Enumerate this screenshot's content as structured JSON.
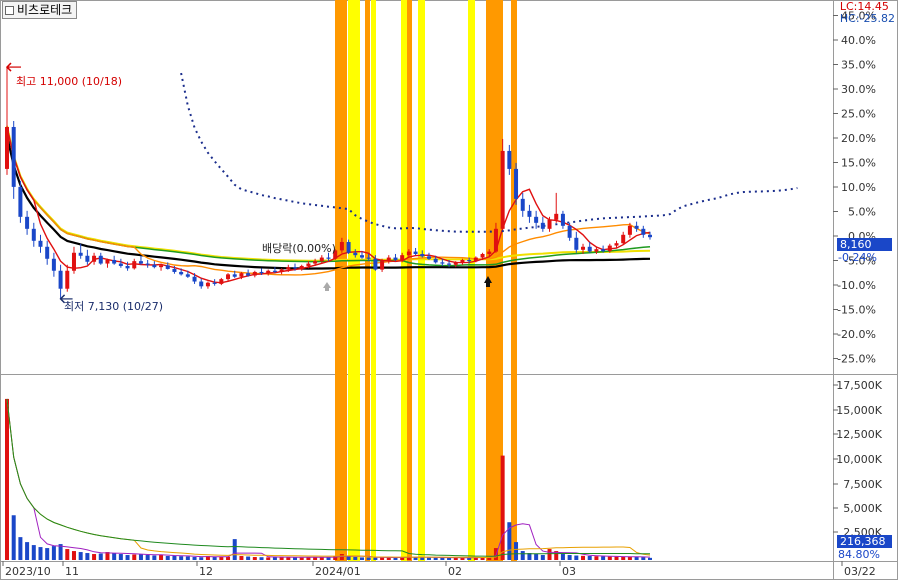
{
  "header": {
    "ticker": "비츠로테크"
  },
  "legend": {
    "lc": "LC:14.45",
    "hc": "HC:-25.82"
  },
  "current_price": "8,160",
  "change_pct": "-0.24%",
  "volume_current": "216,368",
  "volume_pct": "84.80%",
  "annotations": {
    "high": "최고 11,000 (10/18)",
    "low": "최저 7,130 (10/27)",
    "dividend": "배당락(0.00%)"
  },
  "colors": {
    "up": "#e01010",
    "down": "#1a47c8",
    "ma5": "#e01010",
    "ma20": "#ff8c00",
    "ma60": "#1f9a1f",
    "ma120": "#000000",
    "ma_long": "#f0e000",
    "band_orange": "#ff9900",
    "band_yellow": "#ffff00",
    "dotted": "#1a2d8c"
  },
  "chart_data": [
    {
      "type": "candlestick",
      "title": "비츠로테크",
      "y_axis_ticks": [
        "45.0%",
        "40.0%",
        "35.0%",
        "30.0%",
        "25.0%",
        "20.0%",
        "15.0%",
        "10.0%",
        "5.0%",
        "0.0%",
        "-5.0%",
        "-10.0%",
        "-15.0%",
        "-20.0%",
        "-25.0%"
      ],
      "x_axis_ticks": [
        "2023/10",
        "11",
        "12",
        "2024/01",
        "02",
        "03",
        "03/22"
      ],
      "ylim_pct": [
        -25,
        47
      ],
      "reference_price": 8180,
      "current_price": 8160,
      "high": {
        "price": 11000,
        "date": "10/18"
      },
      "low": {
        "price": 7130,
        "date": "10/27"
      },
      "ohlc": [
        [
          9300,
          11000,
          9200,
          10000
        ],
        [
          10000,
          10100,
          8800,
          9000
        ],
        [
          9000,
          9100,
          8400,
          8500
        ],
        [
          8500,
          8600,
          8200,
          8300
        ],
        [
          8300,
          8400,
          8000,
          8100
        ],
        [
          8100,
          8200,
          7900,
          8000
        ],
        [
          8000,
          8100,
          7700,
          7800
        ],
        [
          7800,
          7900,
          7500,
          7600
        ],
        [
          7600,
          7700,
          7130,
          7300
        ],
        [
          7300,
          7700,
          7250,
          7600
        ],
        [
          7600,
          8000,
          7550,
          7900
        ],
        [
          7900,
          8050,
          7800,
          7850
        ],
        [
          7850,
          7950,
          7700,
          7750
        ],
        [
          7750,
          7900,
          7700,
          7850
        ],
        [
          7850,
          7900,
          7700,
          7720
        ],
        [
          7720,
          7800,
          7650,
          7780
        ],
        [
          7780,
          7850,
          7700,
          7720
        ],
        [
          7720,
          7800,
          7650,
          7680
        ],
        [
          7680,
          7750,
          7600,
          7640
        ],
        [
          7640,
          7800,
          7620,
          7760
        ],
        [
          7760,
          7850,
          7700,
          7720
        ],
        [
          7720,
          7780,
          7650,
          7700
        ],
        [
          7700,
          7760,
          7640,
          7660
        ],
        [
          7660,
          7720,
          7600,
          7690
        ],
        [
          7690,
          7740,
          7620,
          7630
        ],
        [
          7630,
          7680,
          7550,
          7580
        ],
        [
          7580,
          7640,
          7520,
          7540
        ],
        [
          7540,
          7600,
          7480,
          7500
        ],
        [
          7500,
          7560,
          7380,
          7420
        ],
        [
          7420,
          7470,
          7300,
          7340
        ],
        [
          7340,
          7420,
          7300,
          7400
        ],
        [
          7400,
          7460,
          7350,
          7380
        ],
        [
          7380,
          7480,
          7360,
          7460
        ],
        [
          7460,
          7560,
          7430,
          7540
        ],
        [
          7540,
          7600,
          7480,
          7500
        ],
        [
          7500,
          7580,
          7460,
          7560
        ],
        [
          7560,
          7620,
          7500,
          7520
        ],
        [
          7520,
          7600,
          7490,
          7580
        ],
        [
          7580,
          7640,
          7530,
          7560
        ],
        [
          7560,
          7620,
          7520,
          7600
        ],
        [
          7600,
          7660,
          7560,
          7580
        ],
        [
          7580,
          7640,
          7540,
          7620
        ],
        [
          7620,
          7700,
          7580,
          7660
        ],
        [
          7660,
          7720,
          7600,
          7640
        ],
        [
          7640,
          7700,
          7600,
          7680
        ],
        [
          7680,
          7760,
          7640,
          7720
        ],
        [
          7720,
          7800,
          7680,
          7760
        ],
        [
          7760,
          7860,
          7720,
          7820
        ],
        [
          7820,
          7900,
          7760,
          7800
        ],
        [
          7800,
          7960,
          7780,
          7940
        ],
        [
          7940,
          8150,
          7900,
          8080
        ],
        [
          8080,
          8120,
          7880,
          7900
        ],
        [
          7900,
          7960,
          7820,
          7860
        ],
        [
          7860,
          7920,
          7800,
          7820
        ],
        [
          7820,
          7880,
          7760,
          7800
        ],
        [
          7800,
          7860,
          7600,
          7620
        ],
        [
          7620,
          7800,
          7580,
          7760
        ],
        [
          7760,
          7860,
          7720,
          7820
        ],
        [
          7820,
          7880,
          7760,
          7780
        ],
        [
          7780,
          7900,
          7740,
          7860
        ],
        [
          7860,
          7960,
          7820,
          7920
        ],
        [
          7920,
          7980,
          7860,
          7880
        ],
        [
          7880,
          7940,
          7820,
          7840
        ],
        [
          7840,
          7900,
          7780,
          7800
        ],
        [
          7800,
          7850,
          7720,
          7740
        ],
        [
          7740,
          7800,
          7680,
          7720
        ],
        [
          7720,
          7780,
          7660,
          7700
        ],
        [
          7700,
          7760,
          7660,
          7740
        ],
        [
          7740,
          7800,
          7700,
          7780
        ],
        [
          7780,
          7820,
          7720,
          7760
        ],
        [
          7760,
          7840,
          7740,
          7820
        ],
        [
          7820,
          7900,
          7780,
          7880
        ],
        [
          7880,
          7960,
          7840,
          7920
        ],
        [
          7920,
          8400,
          7900,
          8300
        ],
        [
          8300,
          9800,
          8280,
          9600
        ],
        [
          9600,
          9700,
          9200,
          9300
        ],
        [
          9300,
          9400,
          8700,
          8800
        ],
        [
          8800,
          8900,
          8500,
          8600
        ],
        [
          8600,
          8700,
          8400,
          8500
        ],
        [
          8500,
          8600,
          8300,
          8400
        ],
        [
          8400,
          8500,
          8250,
          8300
        ],
        [
          8300,
          8500,
          8250,
          8450
        ],
        [
          8450,
          8900,
          8400,
          8550
        ],
        [
          8550,
          8600,
          8300,
          8350
        ],
        [
          8350,
          8400,
          8100,
          8150
        ],
        [
          8150,
          8250,
          7900,
          7950
        ],
        [
          7950,
          8050,
          7880,
          8000
        ],
        [
          8000,
          8080,
          7900,
          7920
        ],
        [
          7920,
          8000,
          7880,
          7960
        ],
        [
          7960,
          8020,
          7900,
          7930
        ],
        [
          7930,
          8050,
          7900,
          8020
        ],
        [
          8020,
          8100,
          7980,
          8060
        ],
        [
          8060,
          8250,
          8040,
          8200
        ],
        [
          8200,
          8400,
          8150,
          8350
        ],
        [
          8350,
          8420,
          8250,
          8300
        ],
        [
          8300,
          8350,
          8150,
          8200
        ],
        [
          8200,
          8250,
          8120,
          8160
        ]
      ],
      "volume_k": [
        16200,
        4500,
        2300,
        1800,
        1500,
        1300,
        1200,
        1400,
        1600,
        1100,
        900,
        800,
        700,
        600,
        650,
        800,
        700,
        600,
        500,
        550,
        600,
        500,
        450,
        500,
        400,
        420,
        380,
        350,
        300,
        280,
        400,
        350,
        300,
        320,
        2100,
        400,
        350,
        300,
        280,
        260,
        300,
        320,
        280,
        260,
        240,
        260,
        300,
        280,
        260,
        350,
        600,
        400,
        300,
        260,
        240,
        230,
        280,
        260,
        240,
        260,
        300,
        280,
        260,
        240,
        230,
        220,
        240,
        260,
        230,
        220,
        240,
        260,
        300,
        1200,
        10500,
        3800,
        1800,
        900,
        700,
        600,
        500,
        1100,
        900,
        600,
        500,
        450,
        420,
        400,
        380,
        360,
        340,
        330,
        320,
        310,
        300,
        290,
        216
      ]
    }
  ]
}
